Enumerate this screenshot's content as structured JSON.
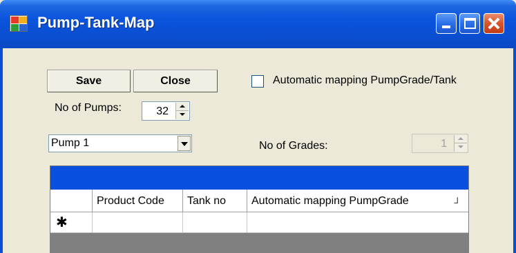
{
  "window": {
    "title": "Pump-Tank-Map"
  },
  "toolbar": {
    "save_label": "Save",
    "close_label": "Close"
  },
  "auto_mapping": {
    "label": "Automatic mapping PumpGrade/Tank",
    "checked": false
  },
  "pumps": {
    "label": "No of Pumps:",
    "value": "32"
  },
  "pump_select": {
    "selected": "Pump 1"
  },
  "grades": {
    "label": "No of Grades:",
    "value": "1",
    "enabled": false
  },
  "grid": {
    "columns": [
      "Product Code",
      "Tank no",
      "Automatic mapping PumpGrade"
    ],
    "sort_glyph": "⅃",
    "new_row_glyph": "✱",
    "rows": []
  },
  "colors": {
    "titlebar": "#0a54dc",
    "window_bg": "#ece9d8",
    "grid_caption": "#0a50e0",
    "grid_bg": "#808080"
  }
}
